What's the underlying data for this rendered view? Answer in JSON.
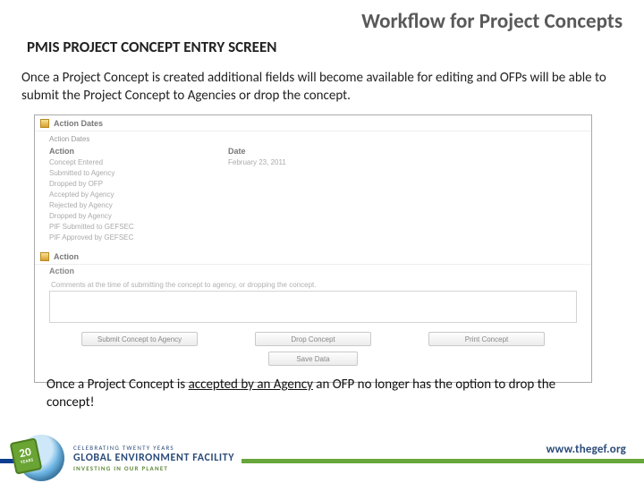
{
  "title": "Workflow for Project Concepts",
  "subtitle": "PMIS PROJECT CONCEPT ENTRY SCREEN",
  "intro": "Once a Project Concept is created additional fields will become available for editing and OFPs will be able to submit the Project Concept to Agencies or drop the concept.",
  "screenshot": {
    "panel1": {
      "title": "Action Dates",
      "subheader": "Action Dates",
      "col_action": "Action",
      "col_date": "Date",
      "rows": [
        {
          "action": "Concept Entered",
          "date": "February 23, 2011"
        },
        {
          "action": "Submitted to Agency",
          "date": ""
        },
        {
          "action": "Dropped by OFP",
          "date": ""
        },
        {
          "action": "Accepted by Agency",
          "date": ""
        },
        {
          "action": "Rejected by Agency",
          "date": ""
        },
        {
          "action": "Dropped by Agency",
          "date": ""
        },
        {
          "action": "PIF Submitted to GEFSEC",
          "date": ""
        },
        {
          "action": "PIF Approved by GEFSEC",
          "date": ""
        }
      ]
    },
    "panel2": {
      "title": "Action",
      "label": "Action",
      "hint": "Comments at the time of submitting the concept to agency, or dropping the concept.",
      "btn_submit": "Submit Concept to Agency",
      "btn_drop": "Drop Concept",
      "btn_print": "Print Concept",
      "btn_save": "Save Data"
    }
  },
  "note_pre": "Once a Project Concept is ",
  "note_underline": "accepted by an Agency",
  "note_post": " an OFP no longer has the option to drop the concept!",
  "footer": {
    "url": "www.thegef.org",
    "ribbon_num": "20",
    "ribbon_word": "YEARS",
    "line1": "CELEBRATING TWENTY YEARS",
    "line2": "GLOBAL ENVIRONMENT FACILITY",
    "line3": "INVESTING IN OUR PLANET"
  }
}
